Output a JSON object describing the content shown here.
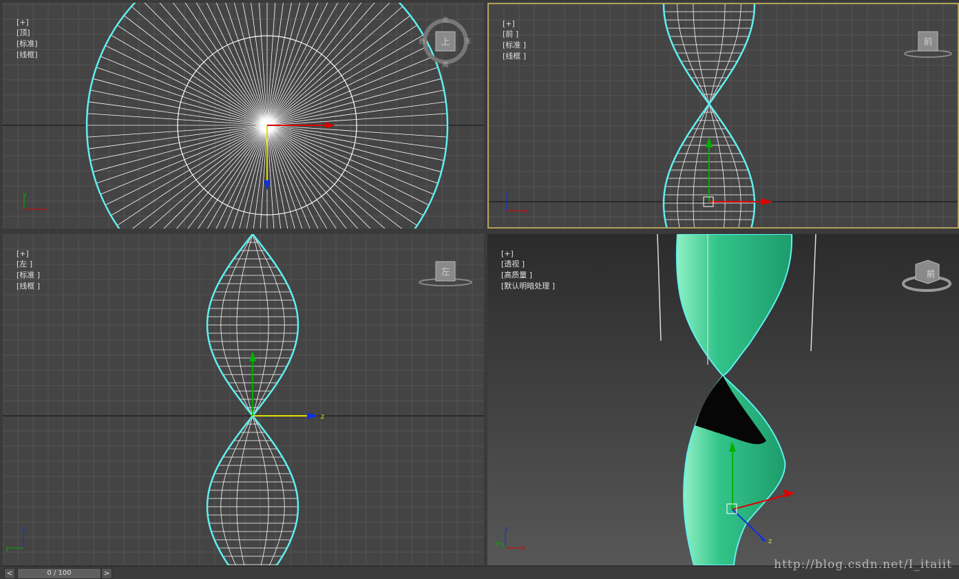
{
  "viewports": {
    "top": {
      "labels": [
        "[+]",
        "[顶]",
        "[标准]",
        "[线框]"
      ],
      "cube_label": "上",
      "compass": {
        "n": "北",
        "s": "南",
        "e": "东",
        "w": "西"
      }
    },
    "front": {
      "labels": [
        "[+]",
        "[前 ]",
        "[标准 ]",
        "[线框 ]"
      ],
      "cube_label": "前"
    },
    "left": {
      "labels": [
        "[+]",
        "[左 ]",
        "[标准 ]",
        "[线框 ]"
      ],
      "cube_label": "左"
    },
    "perspective": {
      "labels": [
        "[+]",
        "[透视 ]",
        "[高质量 ]",
        "[默认明暗处理 ]"
      ],
      "cube_label": "前"
    }
  },
  "axes": {
    "x": "x",
    "y": "y",
    "z": "z"
  },
  "timeline": {
    "prev": "<",
    "position": "0 / 100",
    "next": ">"
  },
  "watermark": "http://blog.csdn.net/I_itaiit",
  "colors": {
    "grid": "#555555",
    "background": "#444444",
    "wire": "#ffffff",
    "selection": "#5ff0f0",
    "surface": "#2fc58a",
    "x_axis": "#e00000",
    "y_axis": "#00b000",
    "z_axis": "#1030e0",
    "active_border": "#b3a25a"
  }
}
